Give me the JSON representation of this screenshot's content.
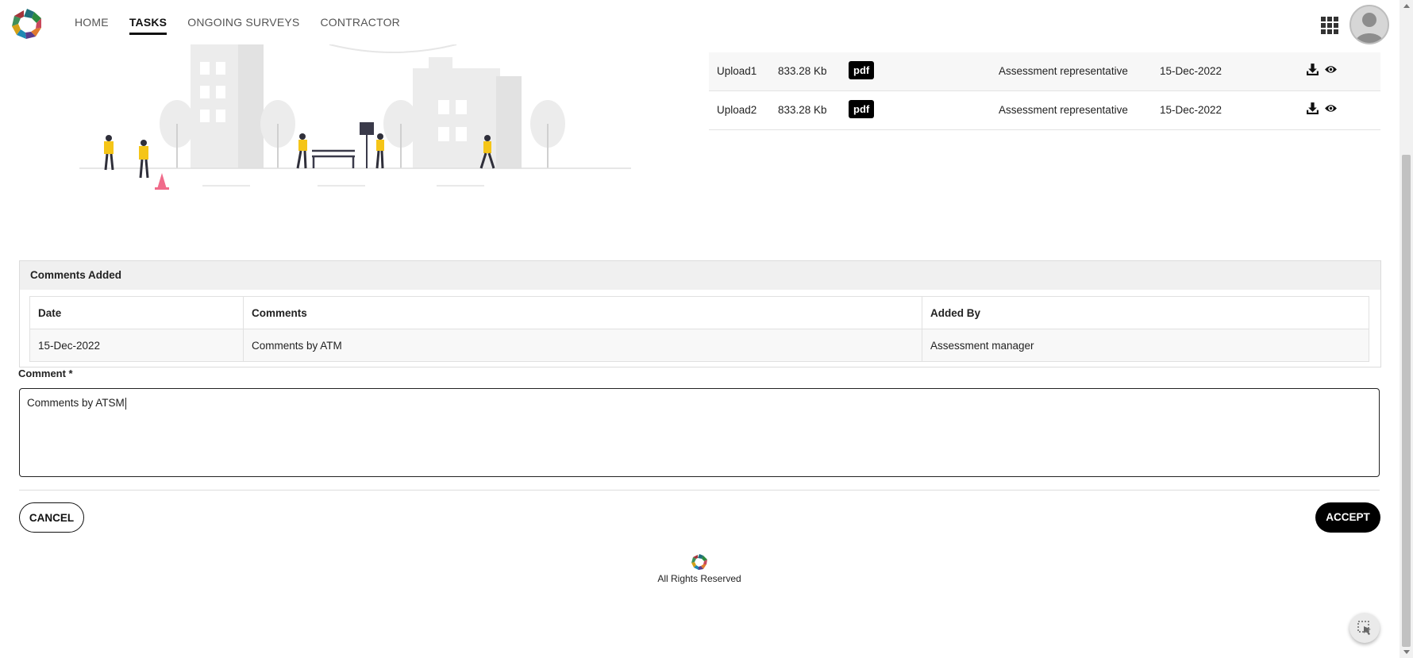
{
  "nav": {
    "items": [
      {
        "label": "HOME"
      },
      {
        "label": "TASKS"
      },
      {
        "label": "ONGOING SURVEYS"
      },
      {
        "label": "CONTRACTOR"
      }
    ],
    "active": "TASKS"
  },
  "icons": {
    "apps": "grid-icon",
    "avatar": "user-avatar-icon",
    "download": "download-icon",
    "view": "eye-icon",
    "float": "cursor-select-icon"
  },
  "uploads": [
    {
      "name": "Upload1",
      "size": "833.28 Kb",
      "type": "pdf",
      "uploaded_by": "Assessment representative",
      "date": "15-Dec-2022"
    },
    {
      "name": "Upload2",
      "size": "833.28 Kb",
      "type": "pdf",
      "uploaded_by": "Assessment representative",
      "date": "15-Dec-2022"
    }
  ],
  "comments_section": {
    "title": "Comments Added",
    "headers": {
      "date": "Date",
      "comments": "Comments",
      "added_by": "Added By"
    },
    "rows": [
      {
        "date": "15-Dec-2022",
        "comment": "Comments by ATM",
        "added_by": "Assessment manager"
      }
    ]
  },
  "comment_field": {
    "label": "Comment *",
    "value": "Comments by ATSM"
  },
  "buttons": {
    "cancel": "CANCEL",
    "accept": "ACCEPT"
  },
  "footer": {
    "text": "All Rights Reserved"
  },
  "colors": {
    "accent": "#000000",
    "illustration_yellow": "#f5c518",
    "cone_pink": "#f06b8a"
  }
}
